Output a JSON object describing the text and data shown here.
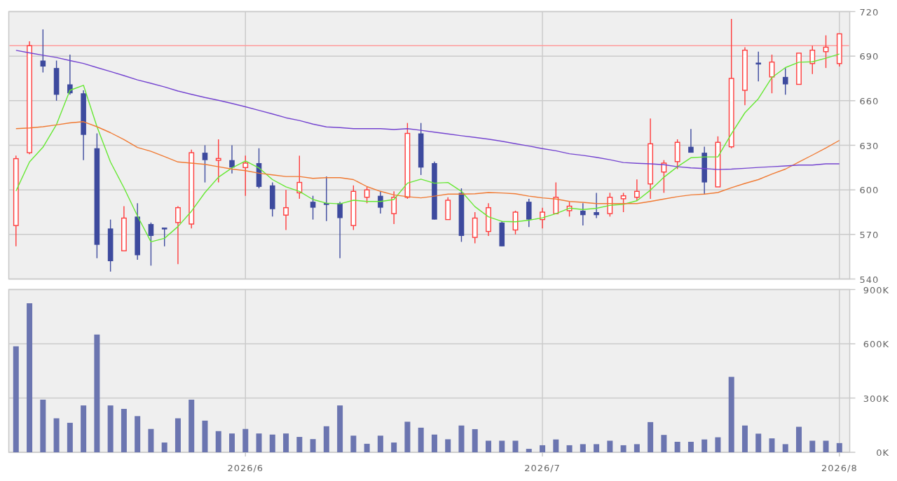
{
  "price": {
    "chart_data": {
      "type": "candlestick",
      "grid": true,
      "categories": [
        null,
        null,
        null,
        null,
        null,
        null,
        null,
        null,
        null,
        null,
        null,
        null,
        null,
        null,
        null,
        null,
        null,
        null,
        null,
        null,
        null,
        null,
        null,
        null,
        null,
        null,
        null,
        null,
        null,
        null,
        null,
        null,
        null,
        null,
        null,
        null,
        null,
        null,
        null,
        null,
        null,
        null,
        null,
        null,
        null,
        null,
        null,
        null,
        null,
        null,
        null,
        null,
        null,
        null,
        null,
        null,
        null,
        null,
        null,
        null,
        null,
        null
      ],
      "ylim": [
        540,
        720
      ],
      "yticks": [
        540,
        570,
        600,
        630,
        660,
        690,
        720
      ],
      "ohlc": [
        [
          576,
          623,
          562,
          621
        ],
        [
          625,
          700,
          624,
          697
        ],
        [
          687,
          708,
          679,
          683
        ],
        [
          682,
          687,
          660,
          664
        ],
        [
          671,
          691,
          664,
          665
        ],
        [
          665,
          667,
          620,
          637
        ],
        [
          628,
          638,
          554,
          563
        ],
        [
          574,
          580,
          545,
          552
        ],
        [
          559,
          589,
          559,
          581
        ],
        [
          582,
          591,
          553,
          556
        ],
        [
          577,
          578,
          549,
          569
        ],
        [
          574,
          574,
          562,
          574
        ],
        [
          578,
          589,
          550,
          588
        ],
        [
          577,
          627,
          574,
          625
        ],
        [
          625,
          630,
          605,
          620
        ],
        [
          620,
          634,
          605,
          621
        ],
        [
          620,
          630,
          611,
          615
        ],
        [
          615,
          623,
          596,
          618
        ],
        [
          618,
          628,
          601,
          602
        ],
        [
          603,
          605,
          582,
          587
        ],
        [
          583,
          600,
          573,
          588
        ],
        [
          598,
          623,
          594,
          605
        ],
        [
          592,
          596,
          580,
          588
        ],
        [
          591,
          609,
          579,
          590
        ],
        [
          591,
          592,
          554,
          581
        ],
        [
          576,
          603,
          573,
          599
        ],
        [
          595,
          602,
          591,
          600
        ],
        [
          596,
          599,
          584,
          588
        ],
        [
          584,
          599,
          577,
          595
        ],
        [
          595,
          645,
          594,
          638
        ],
        [
          638,
          645,
          610,
          615
        ],
        [
          618,
          619,
          580,
          580
        ],
        [
          580,
          595,
          580,
          593
        ],
        [
          598,
          601,
          565,
          569
        ],
        [
          568,
          585,
          564,
          581
        ],
        [
          572,
          591,
          569,
          588
        ],
        [
          578,
          579,
          562,
          562
        ],
        [
          573,
          586,
          570,
          585
        ],
        [
          592,
          594,
          575,
          580
        ],
        [
          580,
          588,
          574,
          585
        ],
        [
          584,
          605,
          584,
          595
        ],
        [
          586,
          592,
          582,
          589
        ],
        [
          586,
          591,
          576,
          583
        ],
        [
          585,
          598,
          581,
          583
        ],
        [
          584,
          598,
          582,
          595
        ],
        [
          594,
          598,
          585,
          596
        ],
        [
          595,
          607,
          593,
          599
        ],
        [
          604,
          648,
          594,
          631
        ],
        [
          612,
          620,
          598,
          618
        ],
        [
          619,
          634,
          614,
          632
        ],
        [
          629,
          641,
          625,
          625
        ],
        [
          625,
          629,
          597,
          605
        ],
        [
          602,
          636,
          602,
          632
        ],
        [
          629,
          715,
          628,
          675
        ],
        [
          667,
          696,
          657,
          694
        ],
        [
          685,
          693,
          673,
          685
        ],
        [
          676,
          691,
          665,
          686
        ],
        [
          676,
          682,
          664,
          671
        ],
        [
          671,
          692,
          671,
          692
        ],
        [
          685,
          697,
          678,
          694
        ],
        [
          693,
          704,
          682,
          696
        ],
        [
          685,
          705,
          683,
          705
        ]
      ],
      "series": [
        {
          "type": "line",
          "color": "#66e833",
          "values": [
            599.3,
            618.8,
            628.7,
            644,
            667,
            670.4,
            642.5,
            618.8,
            601.4,
            582.4,
            565,
            567.4,
            575.3,
            585.6,
            598.2,
            608.5,
            614.8,
            619.5,
            614.8,
            606.9,
            602,
            599,
            593.5,
            591.1,
            590.6,
            593,
            592.2,
            592.2,
            593.5,
            604.5,
            607.2,
            604.5,
            605,
            599,
            588.7,
            581.9,
            578.8,
            578.5,
            579.6,
            581.2,
            584,
            587.7,
            586.8,
            587.6,
            589.5,
            590.3,
            592.7,
            599.8,
            608.5,
            615.6,
            621.6,
            622.2,
            622.2,
            637.7,
            651.9,
            661.4,
            675.6,
            682.3,
            685.9,
            686.2,
            688.6,
            691.4
          ]
        },
        {
          "type": "line",
          "color": "#f07a33",
          "values": [
            641.2,
            641.7,
            642.5,
            643.7,
            645.1,
            645.9,
            642.5,
            638.5,
            633.8,
            628.5,
            625.9,
            622.4,
            618.8,
            618,
            617.2,
            615.6,
            614,
            612.9,
            611.2,
            610.1,
            609,
            609,
            607.7,
            608.2,
            608.2,
            606.9,
            602.2,
            599,
            596.6,
            595.4,
            594.6,
            595.8,
            597.1,
            597.1,
            597.4,
            598.2,
            597.9,
            597.4,
            595.8,
            594.6,
            593.8,
            592.2,
            591.6,
            590.8,
            590.8,
            590.8,
            590.8,
            592.2,
            593.8,
            595.4,
            596.6,
            597.1,
            598.2,
            601.4,
            604.3,
            606.9,
            610.6,
            614,
            618.8,
            623.4,
            628.2,
            633.3
          ]
        },
        {
          "type": "line",
          "color": "#7444d0",
          "values": [
            693.9,
            692.2,
            690.6,
            689.1,
            687,
            685.1,
            682.3,
            679.6,
            676.9,
            674,
            671.7,
            669.3,
            666.5,
            664.3,
            662.2,
            660.3,
            658.2,
            655.9,
            653.5,
            651.1,
            648.5,
            646.7,
            644.3,
            642.4,
            641.9,
            641.2,
            641.2,
            641.2,
            640.6,
            641.2,
            640.1,
            638.8,
            637.7,
            636.4,
            635.3,
            634.1,
            632.7,
            631.1,
            629.5,
            627.8,
            626.3,
            624.3,
            623.2,
            621.9,
            620.3,
            618.4,
            617.9,
            617.5,
            616.9,
            615.6,
            614.8,
            614.3,
            613.7,
            614,
            614.5,
            615.1,
            615.6,
            616.1,
            616.7,
            616.7,
            617.5,
            617.5
          ]
        }
      ],
      "ref_lines": [
        {
          "axis": "y",
          "value": 697,
          "color": "#ff9c9c"
        }
      ]
    }
  },
  "volume": {
    "chart_data": {
      "type": "bar",
      "grid": true,
      "categories": [
        null,
        null,
        null,
        null,
        null,
        null,
        null,
        null,
        null,
        null,
        null,
        null,
        null,
        null,
        null,
        null,
        null,
        "2026/6",
        null,
        null,
        null,
        null,
        null,
        null,
        null,
        null,
        null,
        null,
        null,
        null,
        null,
        null,
        null,
        null,
        null,
        null,
        null,
        null,
        null,
        "2026/7",
        null,
        null,
        null,
        null,
        null,
        null,
        null,
        null,
        null,
        null,
        null,
        null,
        null,
        null,
        null,
        null,
        null,
        null,
        null,
        null,
        null,
        "2026/8"
      ],
      "ylim": [
        0,
        900000
      ],
      "yticks": [
        {
          "value": 0,
          "label": "0K"
        },
        {
          "value": 300000,
          "label": "300K"
        },
        {
          "value": 600000,
          "label": "600K"
        },
        {
          "value": 900000,
          "label": "900K"
        }
      ],
      "series": [
        {
          "color": "#6b75b0",
          "values": [
            586000,
            824000,
            291000,
            188000,
            163000,
            259000,
            651000,
            259000,
            240000,
            200000,
            129000,
            54000,
            188000,
            291000,
            175000,
            117000,
            104000,
            129000,
            104000,
            98000,
            104000,
            85000,
            73000,
            144000,
            259000,
            92000,
            47000,
            92000,
            54000,
            169000,
            136000,
            98000,
            72000,
            148000,
            128000,
            64000,
            64000,
            64000,
            19000,
            39000,
            71000,
            39000,
            45000,
            45000,
            64000,
            39000,
            45000,
            167000,
            96000,
            58000,
            58000,
            71000,
            83000,
            417000,
            148000,
            103000,
            77000,
            45000,
            141000,
            64000,
            64000,
            51000
          ]
        }
      ]
    }
  }
}
